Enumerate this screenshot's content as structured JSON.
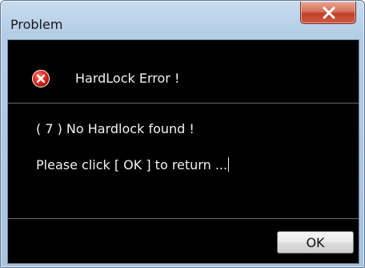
{
  "window": {
    "title": "Problem"
  },
  "header": {
    "icon": "error-icon",
    "text": "HardLock Error !"
  },
  "message": {
    "line1": "( 7 ) No Hardlock found !",
    "line2": "Please click [ OK ] to return ..."
  },
  "buttons": {
    "ok_label": "OK",
    "close_icon": "close-icon"
  },
  "colors": {
    "client_background": "#000000",
    "text": "#f2f2f2",
    "error_red": "#e0261b",
    "close_red": "#c0402a"
  }
}
